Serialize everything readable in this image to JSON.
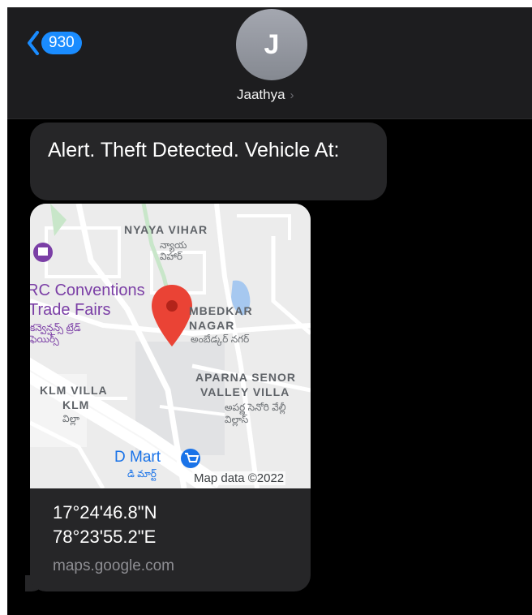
{
  "header": {
    "back_count": "930",
    "avatar_initial": "J",
    "contact_name": "Jaathya",
    "contact_chevron": "›"
  },
  "messages": {
    "alert_text": "Alert. Theft Detected. Vehicle At:",
    "link_preview": {
      "coord_lat": "17°24'46.8\"N",
      "coord_lon": "78°23'55.2\"E",
      "domain": "maps.google.com",
      "map": {
        "label_nyaya_vihar": "NYAYA VIHAR",
        "label_nyaya_vihar_te": "న్యాయ విహార్",
        "label_conventions_1": "RC Conventions",
        "label_conventions_2": "Trade Fairs",
        "label_conventions_te": "కన్వెన్షన్స్ ట్రేడ్ ఫెయిర్స్",
        "label_ambedkar_1": "MBEDKAR",
        "label_ambedkar_2": "NAGAR",
        "label_ambedkar_te": "అంబేడ్కర్ నగర్",
        "label_aparna_1": "APARNA SENOR",
        "label_aparna_2": "VALLEY VILLA",
        "label_aparna_te": "అపర్ణ సెనోరి వేల్లీ విల్లాస్",
        "label_klm_1": "KLM VILLA",
        "label_klm_2": "KLM",
        "label_klm_te": "విల్లా",
        "label_dmart": "D Mart",
        "label_dmart_te": "డి మార్ట్",
        "attribution": "Map data ©2022"
      }
    }
  },
  "colors": {
    "bubble": "#262628",
    "accent": "#1a8cff",
    "pin": "#ea4335"
  }
}
